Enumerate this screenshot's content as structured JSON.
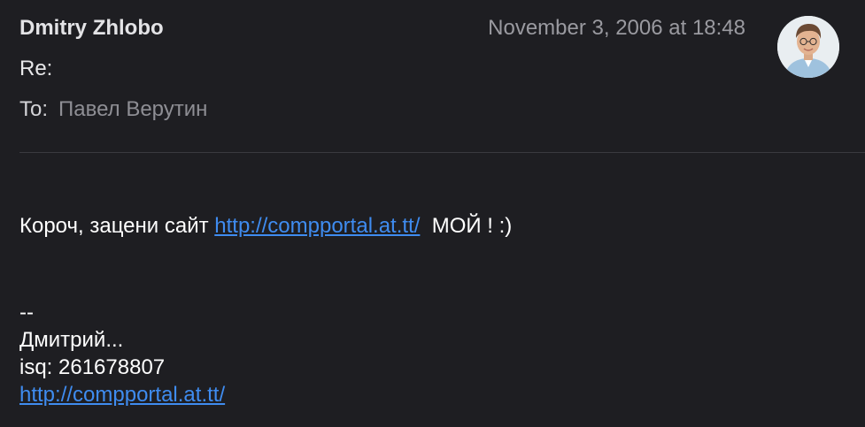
{
  "message": {
    "sender_name": "Dmitry Zhlobo",
    "date": "November 3, 2006 at 18:48",
    "subject_label": "Re:",
    "to_label": "To:",
    "to_name": "Павел Верутин"
  },
  "body": {
    "text_before_link": "Короч, зацени сайт ",
    "link_text": "http://compportal.at.tt/",
    "text_after_link": "  МОЙ ! :)"
  },
  "signature": {
    "separator": "--",
    "name": "Дмитрий...",
    "isq": "isq: 261678807",
    "link_text": "http://compportal.at.tt/"
  },
  "colors": {
    "background": "#1e1e22",
    "link": "#3f8cf0",
    "muted_text": "#9a9aa0"
  }
}
